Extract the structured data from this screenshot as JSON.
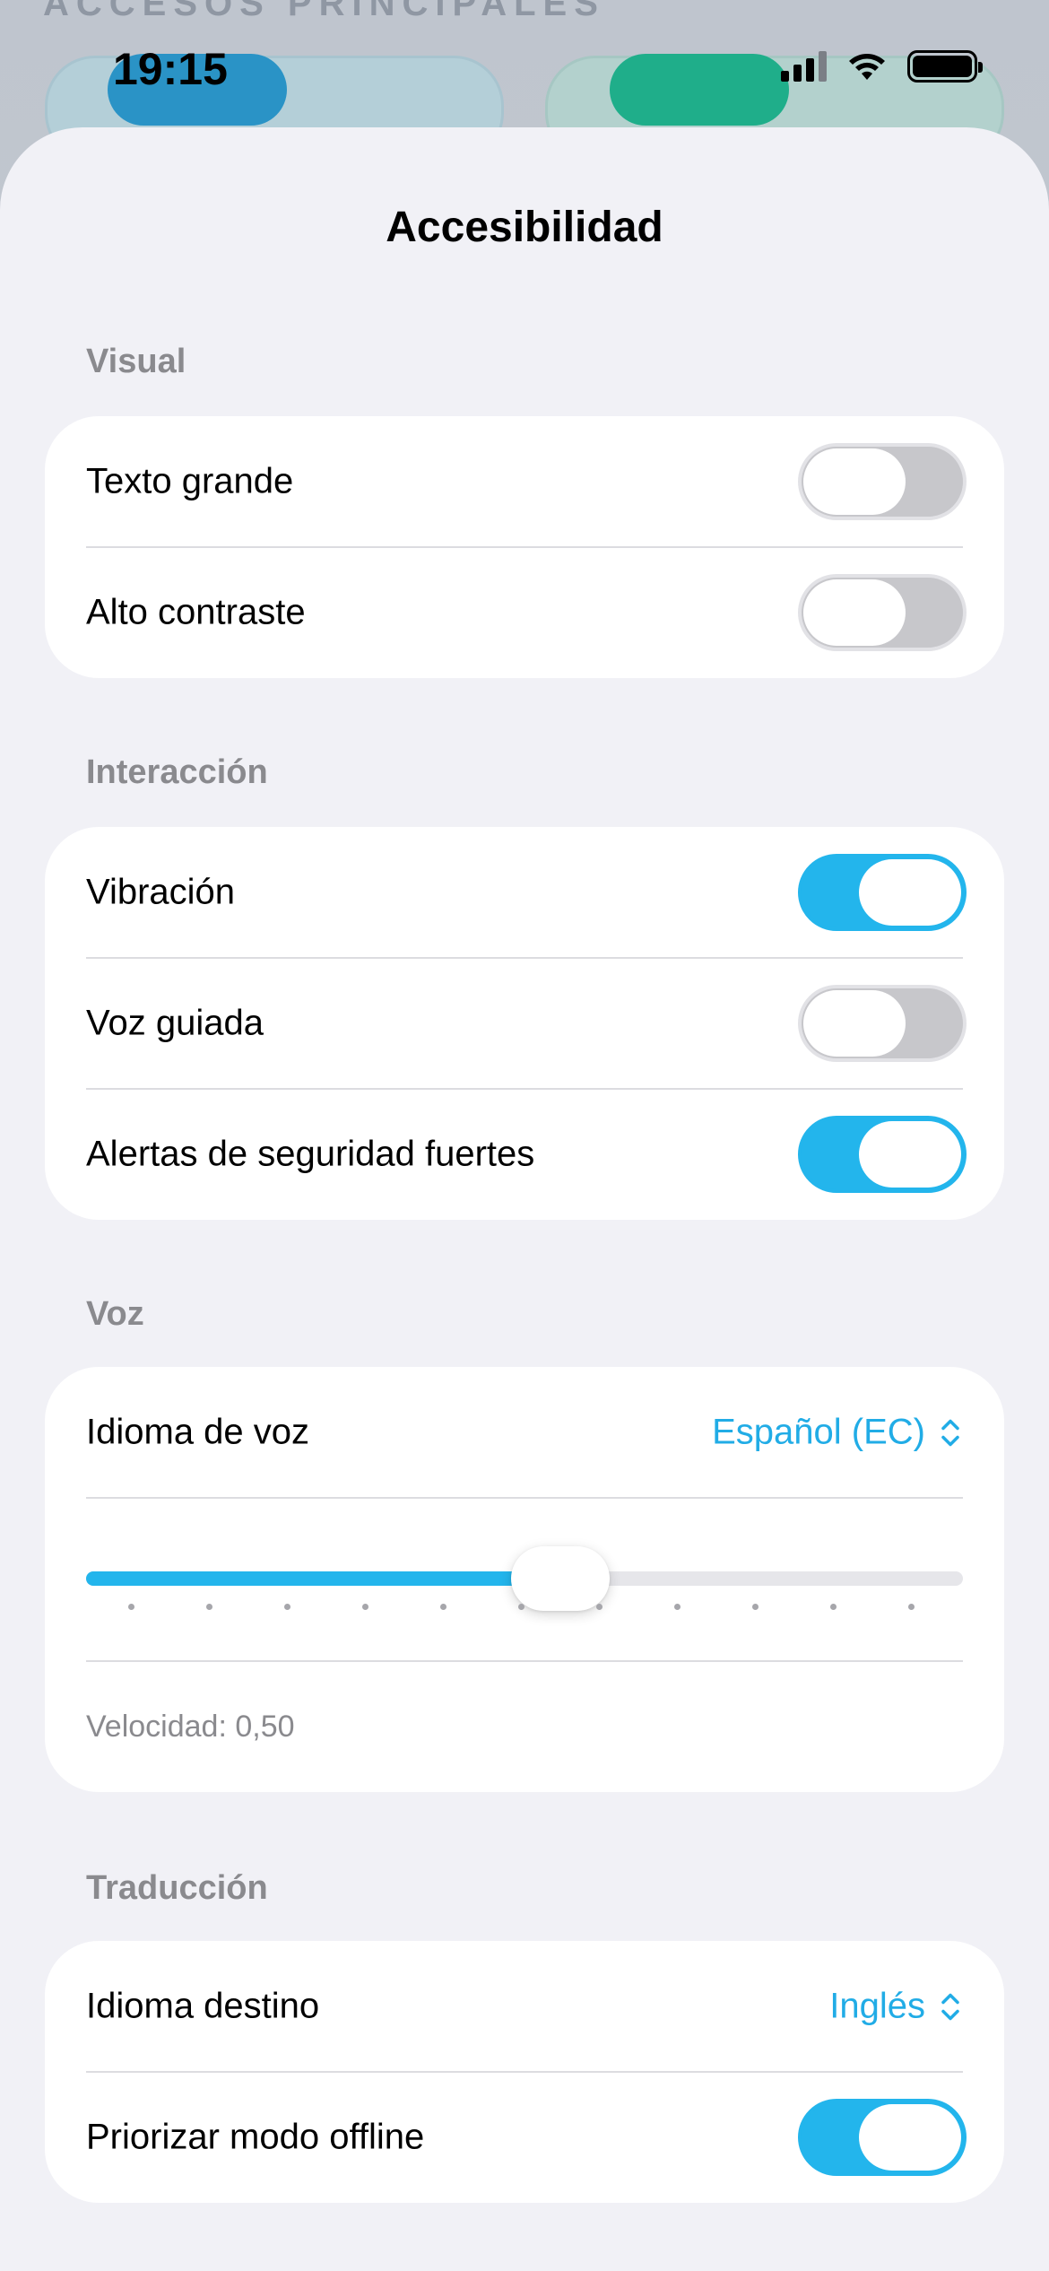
{
  "background": {
    "heading": "ACCESOS PRINCIPALES"
  },
  "status_bar": {
    "time": "19:15",
    "icons": [
      "signal-icon",
      "wifi-icon",
      "battery-icon"
    ]
  },
  "sheet": {
    "title": "Accesibilidad",
    "accent_color": "#23b5ec",
    "sections": {
      "visual": {
        "label": "Visual",
        "rows": [
          {
            "label": "Texto grande",
            "on": false
          },
          {
            "label": "Alto contraste",
            "on": false
          }
        ]
      },
      "interaccion": {
        "label": "Interacción",
        "rows": [
          {
            "label": "Vibración",
            "on": true
          },
          {
            "label": "Voz guiada",
            "on": false
          },
          {
            "label": "Alertas de seguridad fuertes",
            "on": true
          }
        ]
      },
      "voz": {
        "label": "Voz",
        "language_label": "Idioma de voz",
        "language_value": "Español (EC)",
        "speed_label": "Velocidad: 0,50",
        "speed_value": 0.5
      },
      "traduccion": {
        "label": "Traducción",
        "target_label": "Idioma destino",
        "target_value": "Inglés",
        "offline_label": "Priorizar modo offline",
        "offline_on": true
      }
    }
  }
}
